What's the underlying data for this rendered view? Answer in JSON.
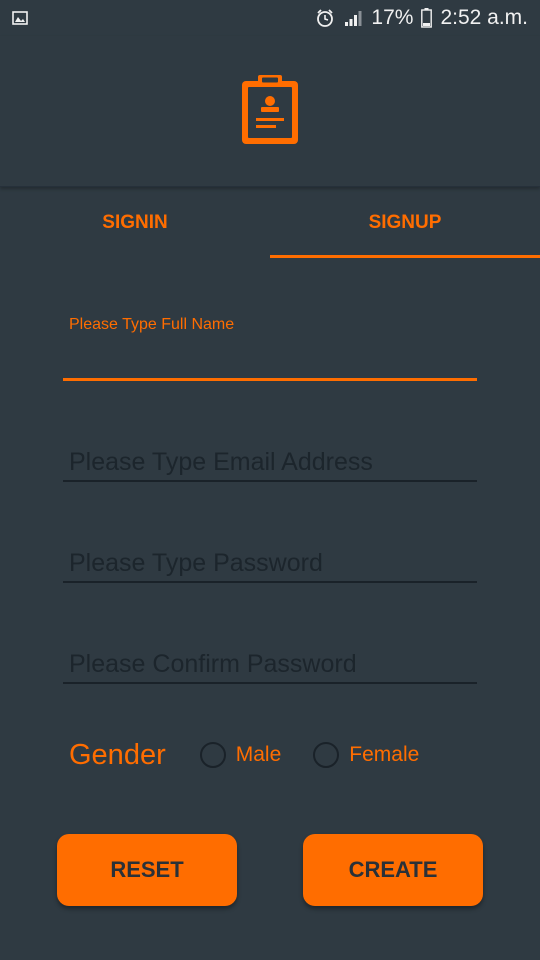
{
  "status_bar": {
    "left_icon": "image-icon",
    "alarm_icon": "alarm-icon",
    "signal_icon": "signal-icon",
    "battery_percent": "17%",
    "battery_icon": "battery-icon",
    "time": "2:52 a.m."
  },
  "header": {
    "logo_icon": "clipboard-badge-icon"
  },
  "tabs": [
    {
      "label": "SIGNIN",
      "active": false
    },
    {
      "label": "SIGNUP",
      "active": true
    }
  ],
  "form": {
    "full_name": {
      "label": "Please Type Full Name",
      "value": ""
    },
    "email": {
      "placeholder": "Please Type Email Address",
      "value": ""
    },
    "password": {
      "placeholder": "Please Type Password",
      "value": ""
    },
    "confirm_password": {
      "placeholder": "Please Confirm Password",
      "value": ""
    },
    "gender": {
      "label": "Gender",
      "options": [
        "Male",
        "Female"
      ],
      "selected": null
    }
  },
  "buttons": {
    "reset": "RESET",
    "create": "CREATE"
  },
  "colors": {
    "accent": "#ff6d00",
    "background": "#2f3a42",
    "underline_inactive": "#1a2229",
    "button_text": "#2a3138"
  }
}
